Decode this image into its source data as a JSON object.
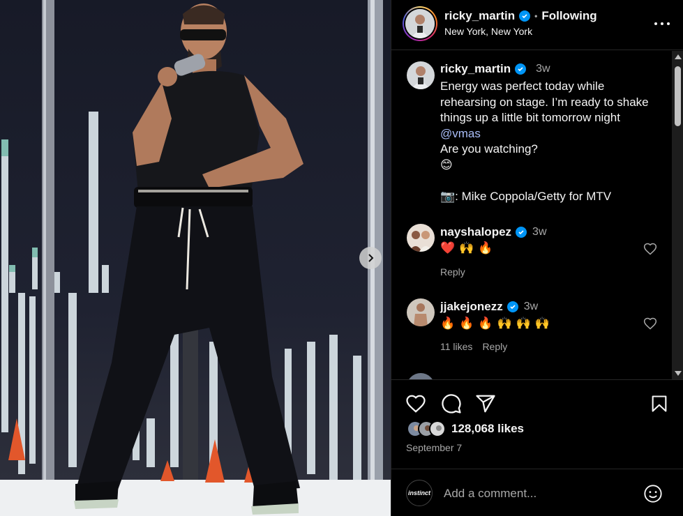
{
  "header": {
    "username": "ricky_martin",
    "separator": "•",
    "follow_status": "Following",
    "location": "New York, New York"
  },
  "caption": {
    "username": "ricky_martin",
    "time": "3w",
    "lines": [
      "Energy was perfect today while",
      "rehearsing on stage. I’m ready to shake",
      "things up a little bit tomorrow night",
      "@vmas",
      "Are you watching?",
      "😊",
      "",
      "📷: Mike Coppola/Getty for MTV"
    ]
  },
  "comments": [
    {
      "username": "nayshalopez",
      "time": "3w",
      "text": "❤️🙌🔥",
      "likes": "",
      "reply": "Reply"
    },
    {
      "username": "jjakejonezz",
      "time": "3w",
      "text": "🔥🔥🔥🙌🙌🙌",
      "likes": "11 likes",
      "reply": "Reply"
    }
  ],
  "likes": {
    "count_text": "128,068 likes"
  },
  "date": "September 7",
  "comment_input": {
    "placeholder": "Add a comment...",
    "avatar_label": "instinct"
  },
  "colors": {
    "verified": "#0095f6",
    "mention": "#a9bdf8",
    "heart": "#ff3040"
  }
}
